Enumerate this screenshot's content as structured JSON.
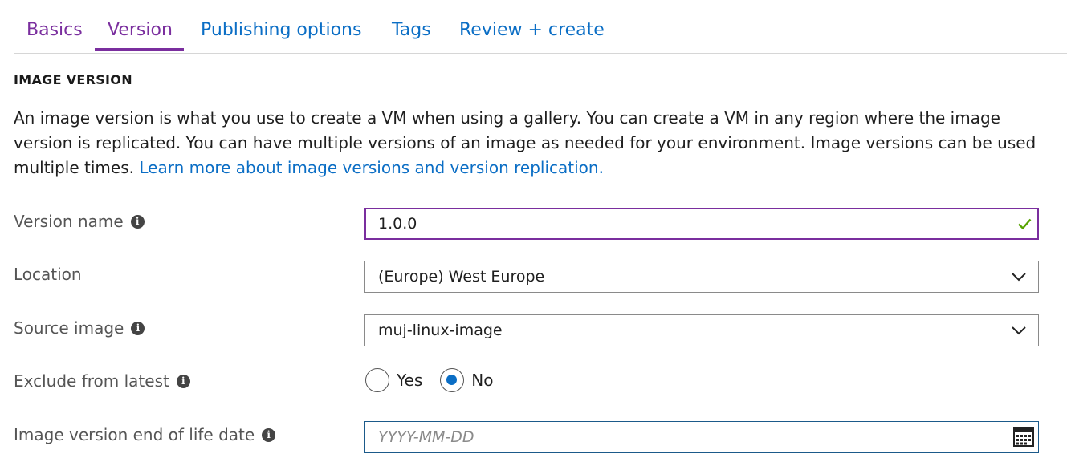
{
  "tabs": [
    {
      "label": "Basics",
      "state": "visited"
    },
    {
      "label": "Version",
      "state": "active"
    },
    {
      "label": "Publishing options",
      "state": "default"
    },
    {
      "label": "Tags",
      "state": "default"
    },
    {
      "label": "Review + create",
      "state": "default"
    }
  ],
  "section": {
    "title": "IMAGE VERSION",
    "description": "An image version is what you use to create a VM when using a gallery. You can create a VM in any region where the image version is replicated. You can have multiple versions of an image as needed for your environment. Image versions can be used multiple times.",
    "learn_more_link": "Learn more about image versions and version replication."
  },
  "form": {
    "version_name": {
      "label": "Version name",
      "value": "1.0.0",
      "status_icon": "checkmark-icon"
    },
    "location": {
      "label": "Location",
      "selected": "(Europe) West Europe"
    },
    "source_image": {
      "label": "Source image",
      "selected": "muj-linux-image"
    },
    "exclude_from_latest": {
      "label": "Exclude from latest",
      "options": [
        "Yes",
        "No"
      ],
      "selected": "No"
    },
    "end_of_life_date": {
      "label": "Image version end of life date",
      "value": "",
      "placeholder": "YYYY-MM-DD"
    }
  },
  "colors": {
    "accent_purple": "#7a2e9e",
    "link_blue": "#0b6ec5",
    "valid_green": "#57a300",
    "radio_blue": "#0b6ec5"
  }
}
